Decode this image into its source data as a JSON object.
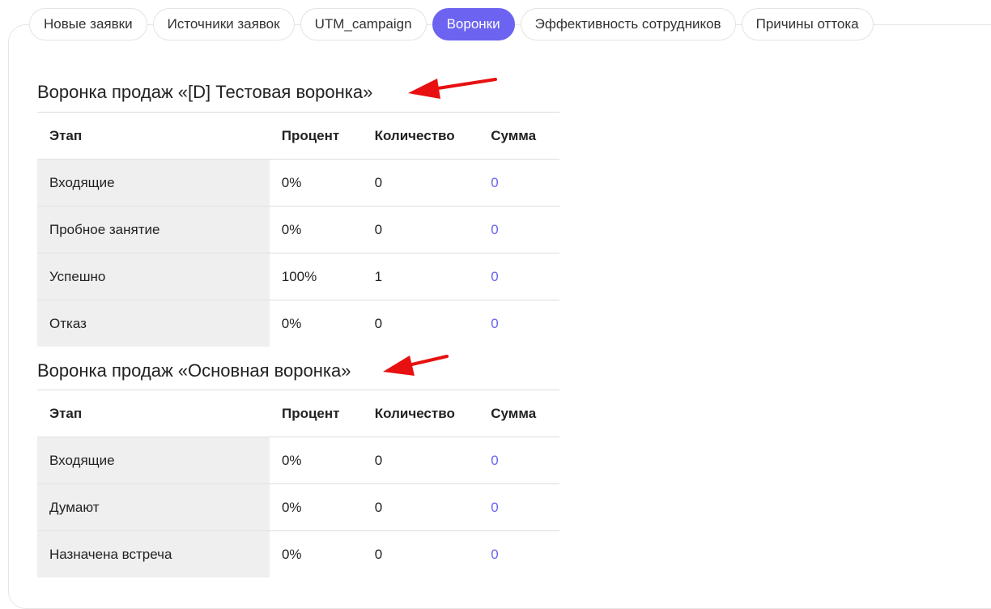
{
  "tabs": [
    {
      "label": "Новые заявки",
      "active": false
    },
    {
      "label": "Источники заявок",
      "active": false
    },
    {
      "label": "UTM_campaign",
      "active": false
    },
    {
      "label": "Воронки",
      "active": true
    },
    {
      "label": "Эффективность сотрудников",
      "active": false
    },
    {
      "label": "Причины оттока",
      "active": false
    }
  ],
  "columns": {
    "stage": "Этап",
    "percent": "Процент",
    "count": "Количество",
    "sum": "Сумма"
  },
  "funnels": [
    {
      "title": "Воронка продаж «[D] Тестовая воронка»",
      "rows": [
        {
          "stage": "Входящие",
          "percent": "0%",
          "count": "0",
          "sum": "0"
        },
        {
          "stage": "Пробное занятие",
          "percent": "0%",
          "count": "0",
          "sum": "0"
        },
        {
          "stage": "Успешно",
          "percent": "100%",
          "count": "1",
          "sum": "0"
        },
        {
          "stage": "Отказ",
          "percent": "0%",
          "count": "0",
          "sum": "0"
        }
      ]
    },
    {
      "title": "Воронка продаж «Основная воронка»",
      "rows": [
        {
          "stage": "Входящие",
          "percent": "0%",
          "count": "0",
          "sum": "0"
        },
        {
          "stage": "Думают",
          "percent": "0%",
          "count": "0",
          "sum": "0"
        },
        {
          "stage": "Назначена встреча",
          "percent": "0%",
          "count": "0",
          "sum": "0"
        }
      ]
    }
  ],
  "colors": {
    "accent": "#6c63f0",
    "annotation": "#e81010"
  }
}
